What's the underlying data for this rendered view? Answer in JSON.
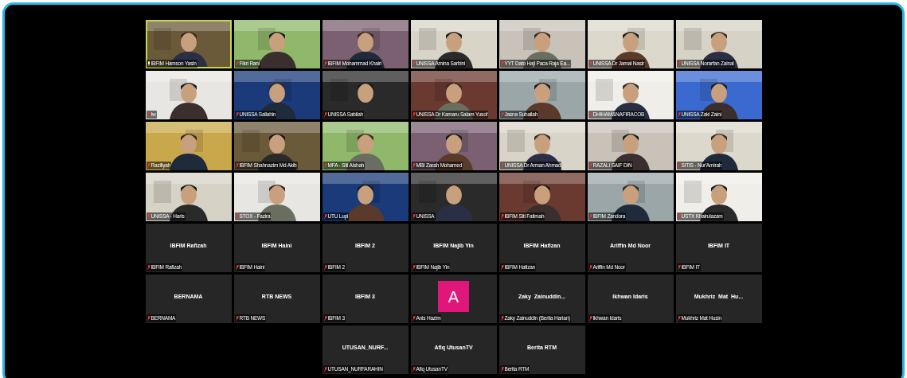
{
  "gallery": {
    "rows": [
      [
        {
          "kind": "video",
          "label": "IBFIM Hamson Yasin",
          "muted": false,
          "speaking": true
        },
        {
          "kind": "video",
          "label": "Fikri Rani",
          "muted": true,
          "speaking": false
        },
        {
          "kind": "video",
          "label": "IBFIM Mohammad Khairi",
          "muted": true,
          "speaking": false
        },
        {
          "kind": "video",
          "label": "UNISSA Amina Sarbini",
          "muted": true,
          "speaking": false
        },
        {
          "kind": "video",
          "label": "YYT Dato Haji Paca Raja Ea...",
          "muted": true,
          "speaking": false
        },
        {
          "kind": "video",
          "label": "UNISSA Dr Jamal Nasir",
          "muted": true,
          "speaking": false
        },
        {
          "kind": "video",
          "label": "UNISSA Norarfan Zainal",
          "muted": true,
          "speaking": false
        }
      ],
      [
        {
          "kind": "video",
          "label": "Iw",
          "muted": true,
          "speaking": false
        },
        {
          "kind": "video",
          "label": "UNISSA Sallahin",
          "muted": true,
          "speaking": false
        },
        {
          "kind": "video",
          "label": "UNISSA Sabilah",
          "muted": true,
          "speaking": false
        },
        {
          "kind": "video",
          "label": "UNISSA Dr Kamaru Salam Yusof",
          "muted": true,
          "speaking": false
        },
        {
          "kind": "video",
          "label": "Jasna Suhailah",
          "muted": true,
          "speaking": false
        },
        {
          "kind": "video",
          "label": "DHIHAM&NAFIRACOB",
          "muted": true,
          "speaking": false
        },
        {
          "kind": "video",
          "label": "UNISSA Zaki Zaini",
          "muted": true,
          "speaking": false
        }
      ],
      [
        {
          "kind": "video",
          "label": "Raziliyah",
          "muted": true,
          "speaking": false
        },
        {
          "kind": "video",
          "label": "IBFIM Shahnazim Md Akib",
          "muted": true,
          "speaking": false
        },
        {
          "kind": "video",
          "label": "MFA - Siti Aishah",
          "muted": true,
          "speaking": false
        },
        {
          "kind": "video",
          "label": "MBI Zarah Mohamed",
          "muted": true,
          "speaking": false
        },
        {
          "kind": "video",
          "label": "UNISSA Dr Arman Ahmad",
          "muted": true,
          "speaking": false
        },
        {
          "kind": "video",
          "label": "RAZALI SAIF DIN",
          "muted": true,
          "speaking": false
        },
        {
          "kind": "video",
          "label": "SITIS - Nur'Amirah",
          "muted": true,
          "speaking": false
        }
      ],
      [
        {
          "kind": "video",
          "label": "UNISSA - Haris",
          "muted": true,
          "speaking": false
        },
        {
          "kind": "video",
          "label": "STOX - Fazira",
          "muted": true,
          "speaking": false
        },
        {
          "kind": "video",
          "label": "UTU Lupi",
          "muted": true,
          "speaking": false
        },
        {
          "kind": "video",
          "label": "UNISSA",
          "muted": true,
          "speaking": false
        },
        {
          "kind": "video",
          "label": "IBFIM Siti Fatimah",
          "muted": true,
          "speaking": false
        },
        {
          "kind": "video",
          "label": "IBFIM Zandora",
          "muted": true,
          "speaking": false
        },
        {
          "kind": "video",
          "label": "USTX Khairulazam",
          "muted": true,
          "speaking": false
        }
      ],
      [
        {
          "kind": "name",
          "name": "IBFIM Rafizah",
          "label": "IBFIM Rafizah",
          "muted": true
        },
        {
          "kind": "name",
          "name": "IBFIM Haini",
          "label": "IBFIM Haini",
          "muted": true
        },
        {
          "kind": "name",
          "name": "IBFIM 2",
          "label": "IBFIM 2",
          "muted": true
        },
        {
          "kind": "name",
          "name": "IBFIM Najib Yin",
          "label": "IBFIM Najib Yin",
          "muted": true
        },
        {
          "kind": "name",
          "name": "IBFIM Hafizan",
          "label": "IBFIM Hafizan",
          "muted": true
        },
        {
          "kind": "name",
          "name": "Ariffin Md Noor",
          "label": "Ariffin Md Noor",
          "muted": true
        },
        {
          "kind": "name",
          "name": "IBFIM IT",
          "label": "IBFIM IT",
          "muted": true
        }
      ],
      [
        {
          "kind": "name",
          "name": "BERNAMA",
          "label": "BERNAMA",
          "muted": true
        },
        {
          "kind": "name",
          "name": "RTB NEWS",
          "label": "RTB NEWS",
          "muted": true
        },
        {
          "kind": "name",
          "name": "IBFIM 3",
          "label": "IBFIM 3",
          "muted": true
        },
        {
          "kind": "avatar",
          "initial": "A",
          "label": "Anis Hazim",
          "muted": true
        },
        {
          "kind": "name",
          "name": "Zaky  Zainuddin...",
          "label": "Zaky Zainuddin (Berita Harian)",
          "muted": true
        },
        {
          "kind": "name",
          "name": "Ikhwan Idaris",
          "label": "Ikhwan Idaris",
          "muted": true
        },
        {
          "kind": "name",
          "name": "Mukhriz  Mat  Hu...",
          "label": "Mukhriz Mat Husin",
          "muted": true
        }
      ],
      [
        "",
        "",
        {
          "kind": "name",
          "name": "UTUSAN_NURF...",
          "label": "UTUSAN_NURFARAHIN",
          "muted": true
        },
        {
          "kind": "name",
          "name": "Afiq UtusanTV",
          "label": "Afiq UtusanTV",
          "muted": true
        },
        {
          "kind": "name",
          "name": "Berita RTM",
          "label": "Berita RTM",
          "muted": true
        }
      ]
    ]
  }
}
